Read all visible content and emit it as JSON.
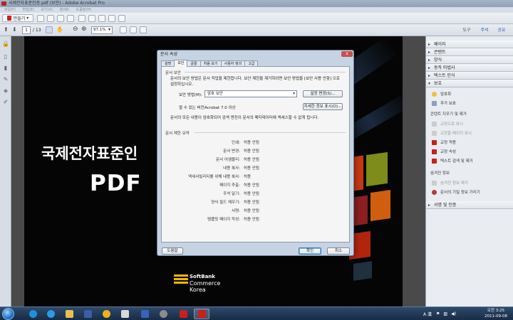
{
  "window": {
    "title": "국제전자표준인증.pdf (보안) - Adobe Acrobat Pro"
  },
  "menubar": {
    "items": [
      "파일(F)",
      "편집(E)",
      "보기(V)",
      "창(W)",
      "도움말(H)"
    ]
  },
  "toolbar": {
    "create_label": "만들기",
    "page_current": "1",
    "page_total": "/ 13",
    "zoom": "97.1%",
    "tools_label": "도구",
    "comment_label": "주석",
    "share_label": "공유"
  },
  "document": {
    "title_line1": "국제전자표준인",
    "title_line2": "PDF",
    "logo_line1": "SoftBank",
    "logo_line2": "Commerce Korea"
  },
  "right_panel": {
    "headers": [
      "페이지",
      "콘텐트",
      "양식",
      "동작 마법사",
      "텍스트 인식",
      "보호",
      "서명 및 인증"
    ],
    "protect_items": [
      {
        "label": "암호화",
        "disabled": false
      },
      {
        "label": "추가 보호",
        "disabled": false
      }
    ],
    "hide_section_title": "콘텐트 지우기 및 제거",
    "hide_items": [
      {
        "label": "교정으로 표시",
        "disabled": true
      },
      {
        "label": "교정할 페이지 표시",
        "disabled": true
      },
      {
        "label": "교정 적용",
        "disabled": false
      },
      {
        "label": "교정 속성",
        "disabled": false
      },
      {
        "label": "텍스트 검색 및 제거",
        "disabled": false
      }
    ],
    "hidden_info_title": "숨겨진 정보",
    "hidden_items": [
      {
        "label": "숨겨진 정보 제거",
        "disabled": true
      },
      {
        "label": "문서의 기밀 정보 가리기",
        "disabled": false
      }
    ]
  },
  "dialog": {
    "title": "문서 속성",
    "close": "x",
    "tabs": [
      "설명",
      "보안",
      "글꼴",
      "처음 보기",
      "사용자 정의",
      "고급"
    ],
    "active_tab": "보안",
    "security_group_title": "문서 보안",
    "security_desc": "문서의 보안 방법은 문서 작업을 제한합니다. 보안 제한을 제거하려면 보안 방법을 [보안 사용 안함] 으로 설정하십시오.",
    "method_label": "보안 방법(M):",
    "method_value": "암호 보안",
    "change_settings_button": "설정 변경(S)...",
    "compat_label": "열 수 있는 버전:",
    "compat_value": "Acrobat 7.0 이상",
    "details_button": "자세한 정보 표시(D)...",
    "encrypt_note": "문서의 모든 내용이 암호화되어 검색 엔진이 문서의 메타데이터에 액세스할 수 없게 됩니다.",
    "restriction_group_title": "문서 제한 요약",
    "restrictions": [
      {
        "label": "인쇄:",
        "value": "허용 안됨"
      },
      {
        "label": "문서 변경:",
        "value": "허용 안됨"
      },
      {
        "label": "문서 어셈블리:",
        "value": "허용 안됨"
      },
      {
        "label": "내용 복사:",
        "value": "허용 안됨"
      },
      {
        "label": "액세서빌리티를 위해 내용 복사:",
        "value": "허용"
      },
      {
        "label": "페이지 추출:",
        "value": "허용 안됨"
      },
      {
        "label": "주석 달기:",
        "value": "허용 안됨"
      },
      {
        "label": "양식 필드 채우기:",
        "value": "허용 안됨"
      },
      {
        "label": "서명:",
        "value": "허용 안됨"
      },
      {
        "label": "템플릿 페이지 작성:",
        "value": "허용 안됨"
      }
    ],
    "help_button": "도움말",
    "ok_button": "확인",
    "cancel_button": "취소"
  },
  "taskbar": {
    "ime": "A 漢",
    "time": "오전 3:25",
    "date": "2011-09-08"
  },
  "colors": {
    "accent": "#2a5fa8",
    "pdf_red": "#c8201f",
    "softbank_yellow": "#f2b800"
  }
}
